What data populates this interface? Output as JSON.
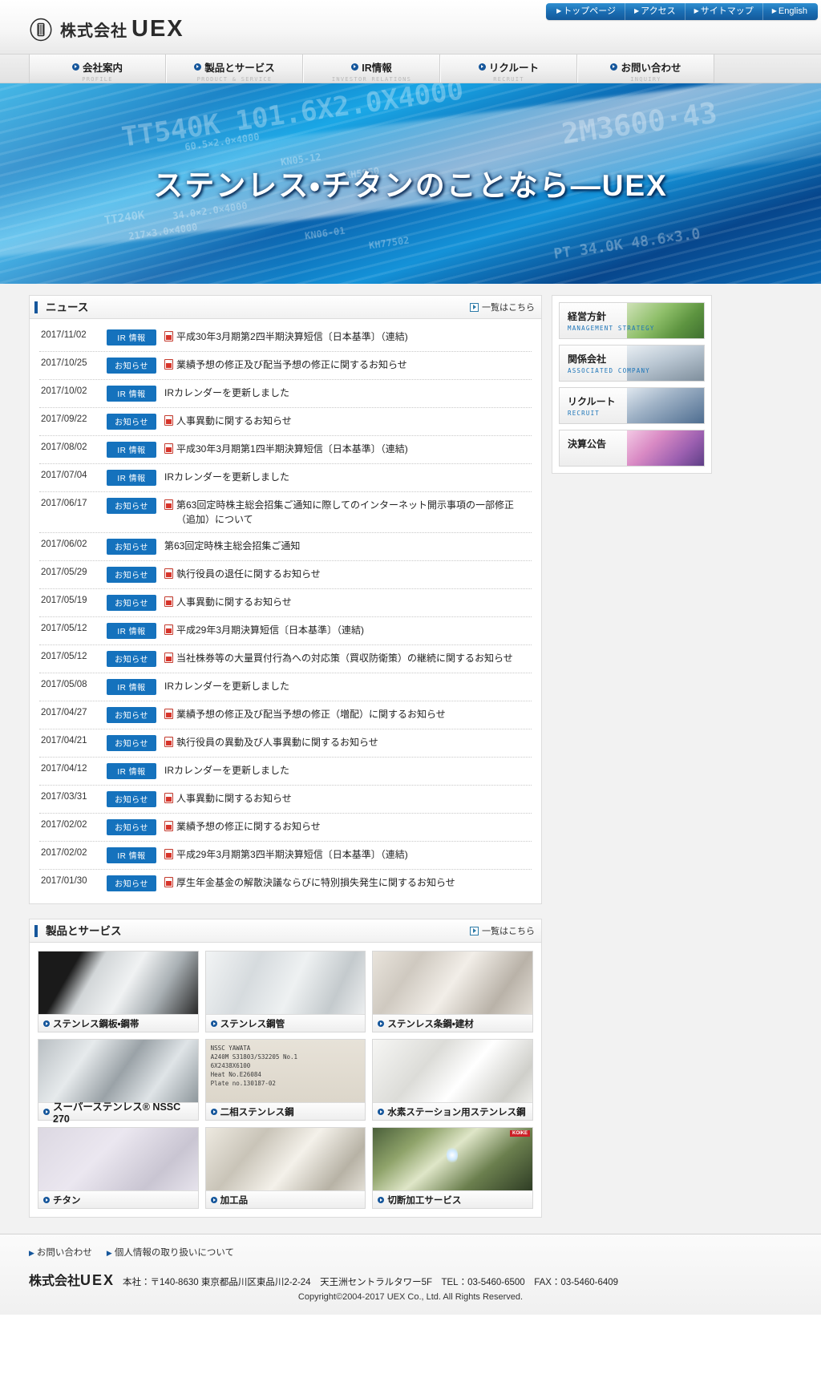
{
  "site": {
    "logo_jp": "株式会社",
    "logo_en": "UEX",
    "logo_icon": "uex-emblem-icon"
  },
  "utility_nav": [
    {
      "label": "トップページ"
    },
    {
      "label": "アクセス"
    },
    {
      "label": "サイトマップ"
    },
    {
      "label": "English"
    }
  ],
  "global_nav": [
    {
      "jp": "会社案内",
      "en": "PROFILE"
    },
    {
      "jp": "製品とサービス",
      "en": "PRODUCT & SERVICE"
    },
    {
      "jp": "IR情報",
      "en": "INVESTOR RELATIONS"
    },
    {
      "jp": "リクルート",
      "en": "RECRUIT"
    },
    {
      "jp": "お問い合わせ",
      "en": "INQUIRY"
    }
  ],
  "hero": {
    "title": "ステンレス・チタンのことなら―UEX",
    "ghost_texts": [
      "TT540K  101.6X2.0X4000",
      "2M3600·43",
      "60.5×2.0×4000",
      "KN05-12",
      "KH5950",
      "TT240K",
      "34.0×2.0×4000",
      "217×3.0×4000",
      "KN06-01",
      "KH77502",
      "PT 34.0K  48.6×3.0"
    ]
  },
  "news": {
    "title": "ニュース",
    "more_label": "一覧はこちら",
    "items": [
      {
        "date": "2017/11/02",
        "tag": "IR 情報",
        "pdf": true,
        "text": "平成30年3月期第2四半期決算短信〔日本基準〕（連結)"
      },
      {
        "date": "2017/10/25",
        "tag": "お知らせ",
        "pdf": true,
        "text": "業績予想の修正及び配当予想の修正に関するお知らせ"
      },
      {
        "date": "2017/10/02",
        "tag": "IR 情報",
        "pdf": false,
        "text": "IRカレンダーを更新しました"
      },
      {
        "date": "2017/09/22",
        "tag": "お知らせ",
        "pdf": true,
        "text": "人事異動に関するお知らせ"
      },
      {
        "date": "2017/08/02",
        "tag": "IR 情報",
        "pdf": true,
        "text": "平成30年3月期第1四半期決算短信〔日本基準〕（連結)"
      },
      {
        "date": "2017/07/04",
        "tag": "IR 情報",
        "pdf": false,
        "text": "IRカレンダーを更新しました"
      },
      {
        "date": "2017/06/17",
        "tag": "お知らせ",
        "pdf": true,
        "text": "第63回定時株主総会招集ご通知に際してのインターネット開示事項の一部修正（追加）について"
      },
      {
        "date": "2017/06/02",
        "tag": "お知らせ",
        "pdf": false,
        "text": "第63回定時株主総会招集ご通知"
      },
      {
        "date": "2017/05/29",
        "tag": "お知らせ",
        "pdf": true,
        "text": "執行役員の退任に関するお知らせ"
      },
      {
        "date": "2017/05/19",
        "tag": "お知らせ",
        "pdf": true,
        "text": "人事異動に関するお知らせ"
      },
      {
        "date": "2017/05/12",
        "tag": "IR 情報",
        "pdf": true,
        "text": "平成29年3月期決算短信〔日本基準〕（連結)"
      },
      {
        "date": "2017/05/12",
        "tag": "お知らせ",
        "pdf": true,
        "text": "当社株券等の大量買付行為への対応策（買収防衛策）の継続に関するお知らせ"
      },
      {
        "date": "2017/05/08",
        "tag": "IR 情報",
        "pdf": false,
        "text": "IRカレンダーを更新しました"
      },
      {
        "date": "2017/04/27",
        "tag": "お知らせ",
        "pdf": true,
        "text": "業績予想の修正及び配当予想の修正（増配）に関するお知らせ"
      },
      {
        "date": "2017/04/21",
        "tag": "お知らせ",
        "pdf": true,
        "text": "執行役員の異動及び人事異動に関するお知らせ"
      },
      {
        "date": "2017/04/12",
        "tag": "IR 情報",
        "pdf": false,
        "text": "IRカレンダーを更新しました"
      },
      {
        "date": "2017/03/31",
        "tag": "お知らせ",
        "pdf": true,
        "text": "人事異動に関するお知らせ"
      },
      {
        "date": "2017/02/02",
        "tag": "お知らせ",
        "pdf": true,
        "text": "業績予想の修正に関するお知らせ"
      },
      {
        "date": "2017/02/02",
        "tag": "IR 情報",
        "pdf": true,
        "text": "平成29年3月期第3四半期決算短信〔日本基準〕（連結)"
      },
      {
        "date": "2017/01/30",
        "tag": "お知らせ",
        "pdf": true,
        "text": "厚生年金基金の解散決議ならびに特別損失発生に関するお知らせ"
      }
    ]
  },
  "side_banners": [
    {
      "jp": "経営方針",
      "en": "MANAGEMENT STRATEGY",
      "art": "trees-photo"
    },
    {
      "jp": "関係会社",
      "en": "ASSOCIATED COMPANY",
      "art": "building-photo"
    },
    {
      "jp": "リクルート",
      "en": "RECRUIT",
      "art": "businesspeople-photo"
    },
    {
      "jp": "決算公告",
      "en": "",
      "art": "pink-abstract-photo"
    }
  ],
  "products": {
    "title": "製品とサービス",
    "more_label": "一覧はこちら",
    "items": [
      {
        "label": "ステンレス鋼板・鋼帯",
        "art": "stainless-plate-photo"
      },
      {
        "label": "ステンレス鋼管",
        "art": "stainless-pipe-photo"
      },
      {
        "label": "ステンレス条鋼・建材",
        "art": "stainless-bar-photo"
      },
      {
        "label": "スーパーステンレス® NSSC 270",
        "art": "super-stainless-photo"
      },
      {
        "label": "二相ステンレス鋼",
        "art": "duplex-stainless-photo"
      },
      {
        "label": "水素ステーション用ステンレス鋼",
        "art": "hydrogen-station-photo"
      },
      {
        "label": "チタン",
        "art": "titanium-photo"
      },
      {
        "label": "加工品",
        "art": "machined-parts-photo"
      },
      {
        "label": "切断加工サービス",
        "art": "cutting-service-photo"
      }
    ],
    "plate_marking": "NSSC YAWATA\nA240M S31803/S32205 No.1\n6X2438X6100\nHeat No.E26084\nPlate no.130187-02"
  },
  "footer": {
    "links": [
      {
        "label": "お問い合わせ"
      },
      {
        "label": "個人情報の取り扱いについて"
      }
    ],
    "company_jp": "株式会社",
    "company_en": "UEX",
    "address": "本社：〒140-8630 東京都品川区東品川2-2-24　天王洲セントラルタワー5F　TEL：03-5460-6500　FAX：03-5460-6409",
    "copyright": "Copyright©2004-2017 UEX Co., Ltd. All Rights Reserved."
  },
  "colors": {
    "brand_blue": "#15569b",
    "tag_blue": "#1572bd",
    "link_blue": "#1b74b8",
    "pdf_red": "#d7342a"
  }
}
